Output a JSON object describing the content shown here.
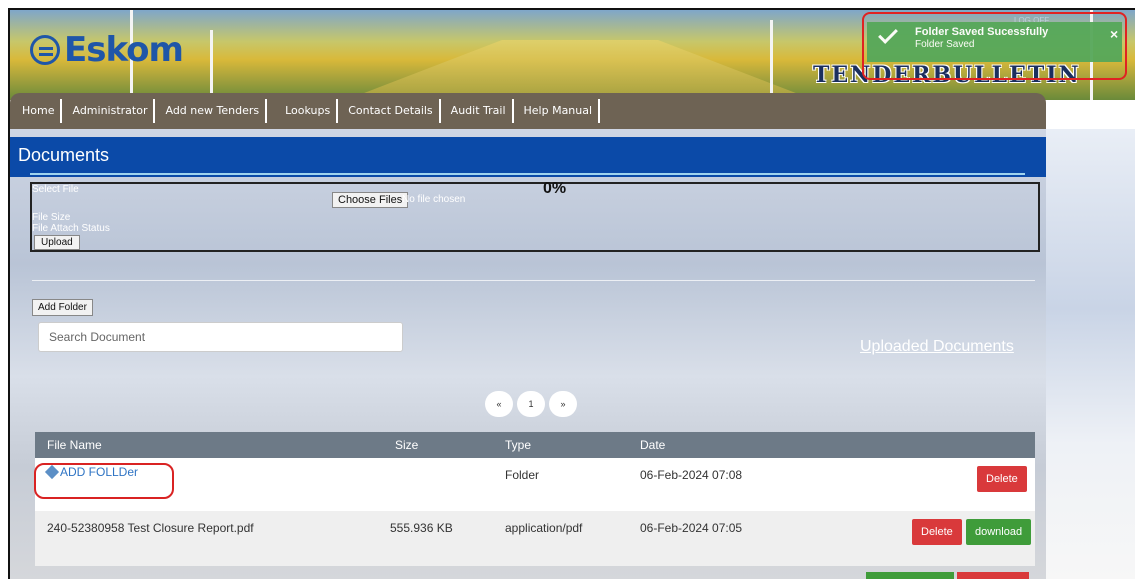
{
  "brand": {
    "logo": "Eskom",
    "site_title": "TENDERBULLETIN"
  },
  "nav": [
    {
      "label": "Home"
    },
    {
      "label": "Administrator"
    },
    {
      "label": "Add new Tenders"
    },
    {
      "label": "Lookups"
    },
    {
      "label": "Contact Details"
    },
    {
      "label": "Audit Trail"
    },
    {
      "label": "Help Manual"
    }
  ],
  "toast": {
    "title": "Folder Saved Sucessfully",
    "message": "Folder Saved",
    "close": "×",
    "logoff": "LOG OFF"
  },
  "documents": {
    "title": "Documents",
    "upload": {
      "select_file_label": "Select File",
      "choose_files": "Choose Files",
      "no_file": "No file chosen",
      "percent": "0%",
      "file_size_label": "File Size",
      "attach_status_label": "File Attach Status",
      "upload_button": "Upload"
    },
    "add_folder": "Add Folder",
    "search_placeholder": "Search Document",
    "uploaded_documents_link": "Uploaded Documents",
    "pager": {
      "prev": "«",
      "page": "1",
      "next": "»"
    }
  },
  "table": {
    "headers": {
      "name": "File Name",
      "size": "Size",
      "type": "Type",
      "date": "Date"
    },
    "rows": [
      {
        "name": "ADD FOLLDer",
        "size": "",
        "type": "Folder",
        "date": "06-Feb-2024 07:08",
        "delete": "Delete"
      },
      {
        "name": "240-52380958 Test Closure Report.pdf",
        "size": "555.936 KB",
        "type": "application/pdf",
        "date": "06-Feb-2024 07:05",
        "delete": "Delete",
        "download": "download"
      }
    ]
  },
  "colors": {
    "header_blue": "#0b4aa8",
    "nav_brown": "#6e6354",
    "delete_red": "#d9393b",
    "download_green": "#3f9c3a",
    "toast_green": "#56a85a",
    "annotation_red": "#e02222"
  }
}
